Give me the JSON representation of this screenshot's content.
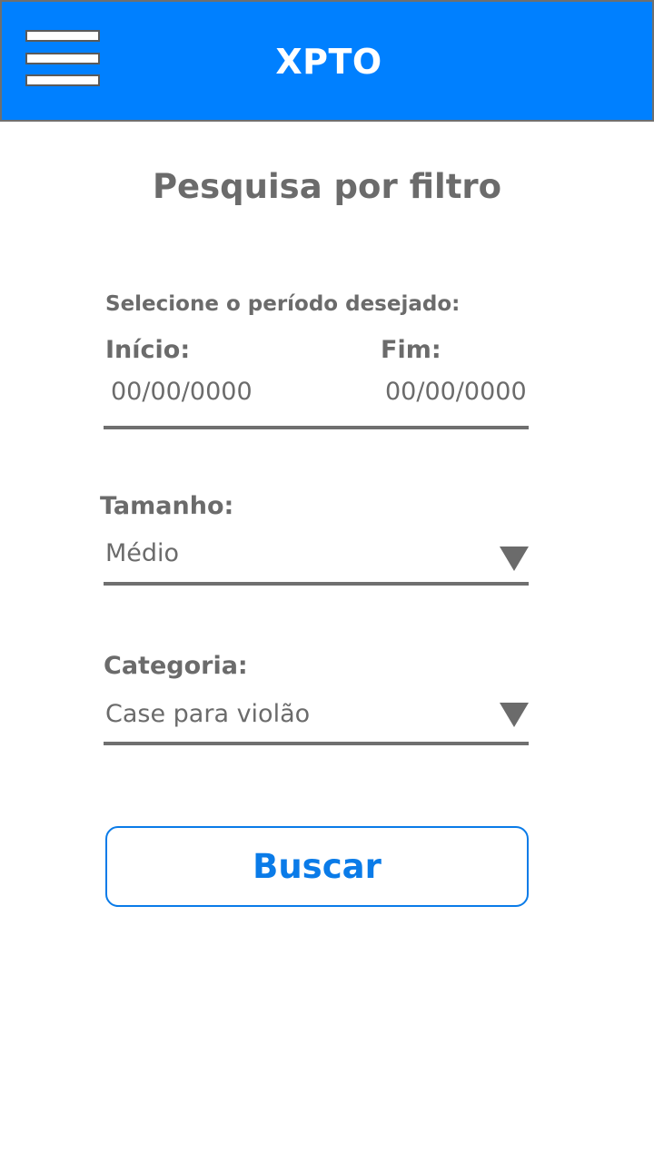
{
  "app": {
    "title": "XPTO"
  },
  "page": {
    "title": "Pesquisa por filtro"
  },
  "period": {
    "label": "Selecione o período desejado:",
    "start_label": "Início:",
    "start_placeholder": "00/00/0000",
    "end_label": "Fim:",
    "end_placeholder": "00/00/0000"
  },
  "size": {
    "label": "Tamanho:",
    "value": "Médio"
  },
  "category": {
    "label": "Categoria:",
    "value": "Case para violão"
  },
  "actions": {
    "search_label": "Buscar"
  },
  "colors": {
    "appbar": "#0080ff",
    "accent": "#0a7be8",
    "text": "#6b6b6b"
  },
  "icons": {
    "menu": "hamburger-menu-icon",
    "dropdown": "chevron-down-icon"
  }
}
